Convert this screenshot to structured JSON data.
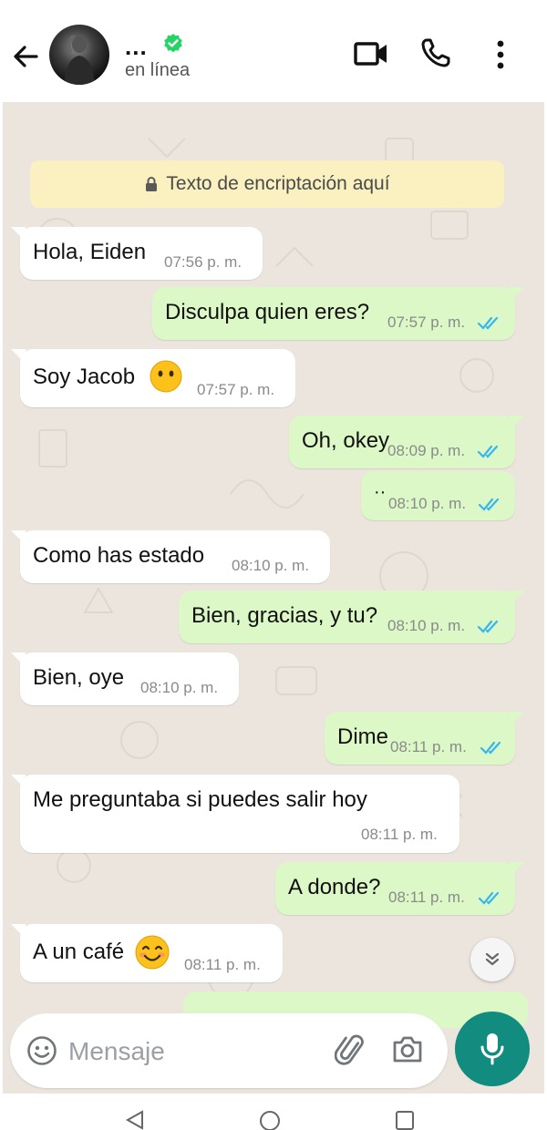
{
  "header": {
    "contact_name": "...",
    "status": "en línea"
  },
  "chat": {
    "encryption_notice": "Texto de encriptación aquí",
    "messages": [
      {
        "dir": "in",
        "text": "Hola, Eiden",
        "time": "07:56 p. m."
      },
      {
        "dir": "out",
        "text": "Disculpa quien eres?",
        "time": "07:57 p. m.",
        "ticks": "read"
      },
      {
        "dir": "in",
        "text": "Soy Jacob",
        "emoji": "neutral-face",
        "time": "07:57 p. m."
      },
      {
        "dir": "out",
        "text": "Oh, okey",
        "time": "08:09 p. m.",
        "ticks": "read"
      },
      {
        "dir": "out",
        "text": "··",
        "time": "08:10 p. m.",
        "ticks": "read"
      },
      {
        "dir": "in",
        "text": "Como has estado",
        "time": "08:10 p. m."
      },
      {
        "dir": "out",
        "text": "Bien, gracias, y tu?",
        "time": "08:10 p. m.",
        "ticks": "read"
      },
      {
        "dir": "in",
        "text": "Bien, oye",
        "time": "08:10 p. m."
      },
      {
        "dir": "out",
        "text": "Dime",
        "time": "08:11 p. m.",
        "ticks": "read"
      },
      {
        "dir": "in",
        "text": "Me preguntaba si puedes salir hoy",
        "time": "08:11 p. m."
      },
      {
        "dir": "out",
        "text": "A donde?",
        "time": "08:11 p. m.",
        "ticks": "read"
      },
      {
        "dir": "in",
        "text": "A un café",
        "emoji": "smiling-face",
        "time": "08:11 p. m."
      }
    ]
  },
  "composer": {
    "placeholder": "Mensaje"
  },
  "colors": {
    "chat_background": "#ece5dd",
    "incoming_bubble": "#ffffff",
    "outgoing_bubble": "#dcf8c6",
    "accent": "#128c7e",
    "read_ticks": "#34b7f1",
    "verified_badge": "#25d366",
    "encryption_banner": "#fbf0c0"
  }
}
